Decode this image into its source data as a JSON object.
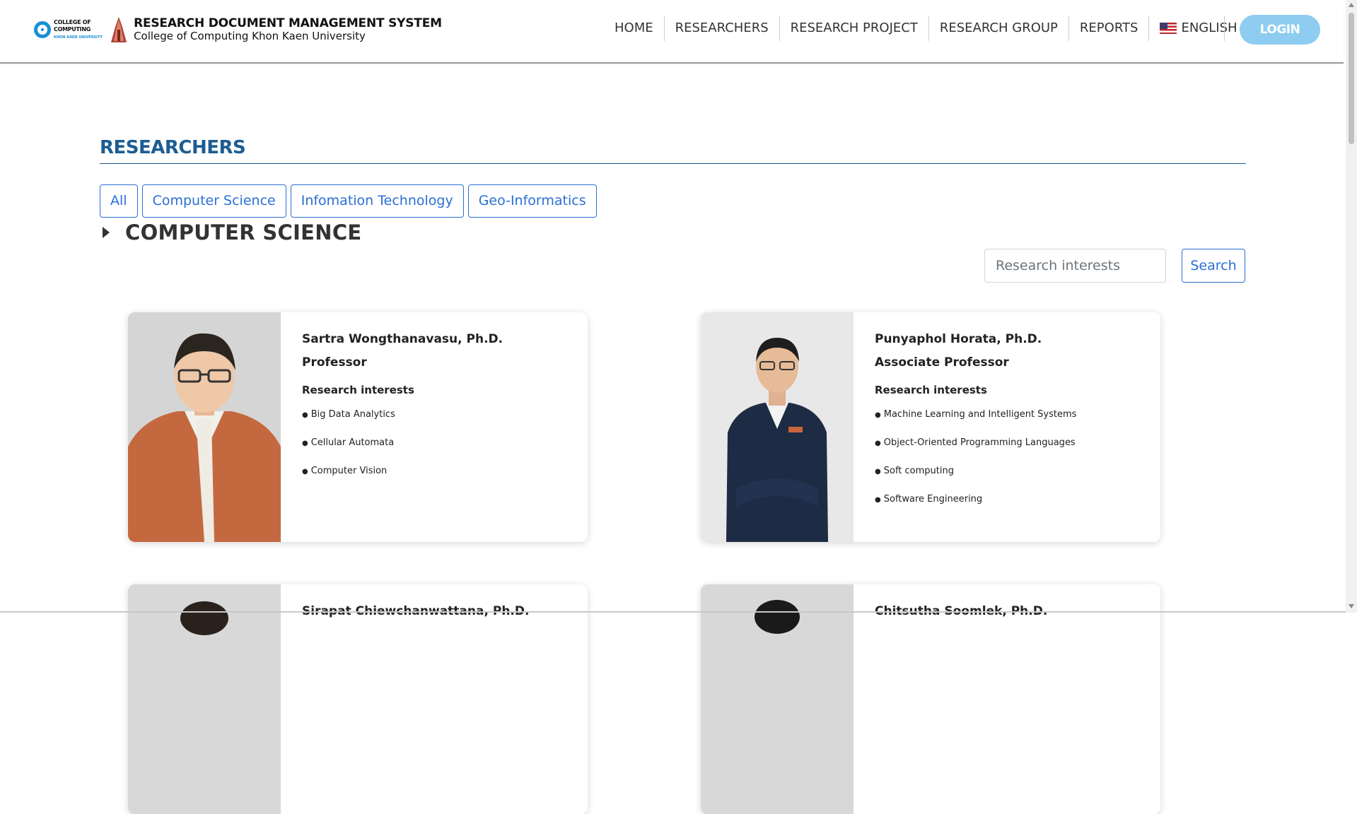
{
  "brand": {
    "college_line1": "COLLEGE OF COMPUTING",
    "college_line2": "KHON KAEN UNIVERSITY",
    "title": "RESEARCH DOCUMENT MANAGEMENT SYSTEM",
    "subtitle": "College of Computing Khon Kaen University"
  },
  "nav": {
    "items": [
      "HOME",
      "RESEARCHERS",
      "RESEARCH PROJECT",
      "RESEARCH GROUP",
      "REPORTS"
    ],
    "language": "ENGLISH",
    "flag_icon": "us-flag-icon",
    "login": "LOGIN"
  },
  "main": {
    "section_title": "RESEARCHERS",
    "filters": [
      "All",
      "Computer Science",
      "Infomation Technology",
      "Geo-Informatics"
    ],
    "group_title": "COMPUTER SCIENCE",
    "search": {
      "placeholder": "Research interests",
      "button": "Search"
    },
    "researchers": [
      {
        "name": "Sartra Wongthanavasu, Ph.D.",
        "position": "Professor",
        "interests_title": "Research interests",
        "interests": [
          "Big Data Analytics",
          "Cellular Automata",
          "Computer Vision"
        ]
      },
      {
        "name": "Punyaphol Horata, Ph.D.",
        "position": "Associate Professor",
        "interests_title": "Research interests",
        "interests": [
          "Machine Learning and Intelligent Systems",
          "Object-Oriented Programming Languages",
          "Soft computing",
          "Software Engineering"
        ]
      },
      {
        "name": "Sirapat Chiewchanwattana, Ph.D.",
        "position": "",
        "interests_title": "",
        "interests": []
      },
      {
        "name": "Chitsutha Soomlek, Ph.D.",
        "position": "",
        "interests_title": "",
        "interests": []
      }
    ]
  },
  "colors": {
    "accent_blue": "#2a6fd4",
    "heading_blue": "#1c5c93",
    "login_bg": "#8ecdf0"
  }
}
